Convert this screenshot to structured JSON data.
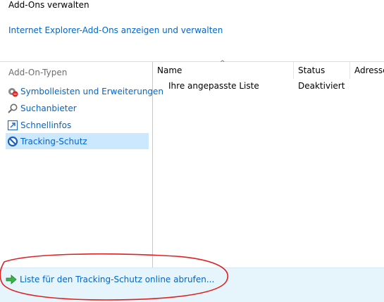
{
  "header": {
    "title": "Add-Ons verwalten",
    "subtitle_link": "Internet Explorer-Add-Ons anzeigen und verwalten"
  },
  "sidebar": {
    "heading": "Add-On-Typen",
    "items": [
      {
        "label": "Symbolleisten und Erweiterungen",
        "icon": "gear-blocked-icon",
        "selected": false
      },
      {
        "label": "Suchanbieter",
        "icon": "magnifier-icon",
        "selected": false
      },
      {
        "label": "Schnellinfos",
        "icon": "accelerator-icon",
        "selected": false
      },
      {
        "label": "Tracking-Schutz",
        "icon": "no-entry-icon",
        "selected": true
      }
    ]
  },
  "table": {
    "columns": [
      "Name",
      "Status",
      "Adresse"
    ],
    "rows": [
      {
        "name": "Ihre angepasste Liste",
        "status": "Deaktiviert",
        "address": ""
      }
    ]
  },
  "footer": {
    "link_label": "Liste für den Tracking-Schutz online abrufen...",
    "icon": "green-arrow-icon"
  },
  "colors": {
    "link": "#0066cc",
    "selection": "#cce8ff",
    "footer_bg": "#e6f4fb",
    "annotation": "#e02020"
  }
}
